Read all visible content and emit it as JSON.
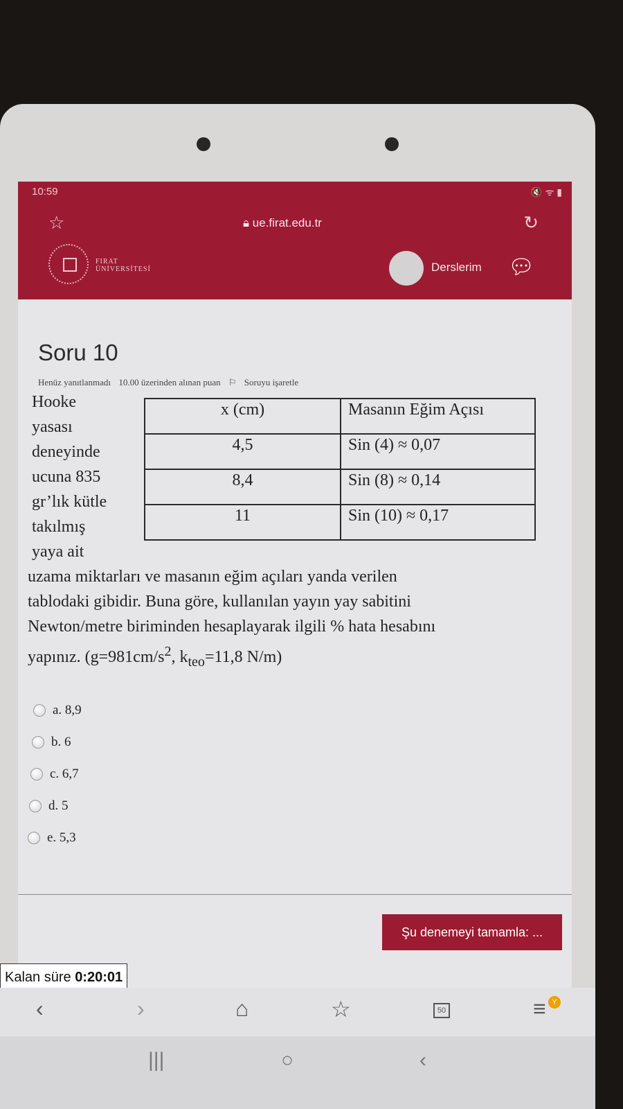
{
  "status": {
    "time": "10:59",
    "icons": "🔇 ᯤ ▮"
  },
  "browser": {
    "url": "ue.firat.edu.tr"
  },
  "site": {
    "logo_line1": "FIRAT",
    "logo_line2": "ÜNİVERSİTESİ",
    "nav_label": "Derslerim"
  },
  "question": {
    "title": "Soru 10",
    "status": "Henüz yanıtlanmadı",
    "points": "10.00 üzerinden alınan puan",
    "flag_label": "Soruyu işaretle",
    "stem_left": [
      "Hooke",
      "yasası",
      "deneyinde",
      "ucuna 835",
      "gr’lık kütle",
      "takılmış",
      "yaya ait"
    ],
    "stem_rest_1": "uzama miktarları ve masanın eğim açıları yanda verilen",
    "stem_rest_2": "tablodaki gibidir. Buna göre, kullanılan yayın yay sabitini",
    "stem_rest_3": "Newton/metre biriminden hesaplayarak ilgili % hata hesabını",
    "stem_rest_4a": "yapınız. (g=981cm/s",
    "sup2": "2",
    "stem_rest_4b": ", k",
    "sub_teo": "teo",
    "stem_rest_4c": "=11,8 N/m)",
    "table": {
      "headers": [
        "x (cm)",
        "Masanın Eğim Açısı"
      ],
      "rows": [
        [
          "4,5",
          "Sin (4) ≈ 0,07"
        ],
        [
          "8,4",
          "Sin (8) ≈ 0,14"
        ],
        [
          "11",
          "Sin (10) ≈ 0,17"
        ]
      ]
    },
    "options": [
      "a. 8,9",
      "b. 6",
      "c. 6,7",
      "d. 5",
      "e. 5,3"
    ]
  },
  "finish_button": "Şu denemeyi tamamla: ...",
  "timer": {
    "label": "Kalan süre",
    "value": "0:20:01"
  },
  "tabs_count": "50",
  "notification_badge": "Y"
}
